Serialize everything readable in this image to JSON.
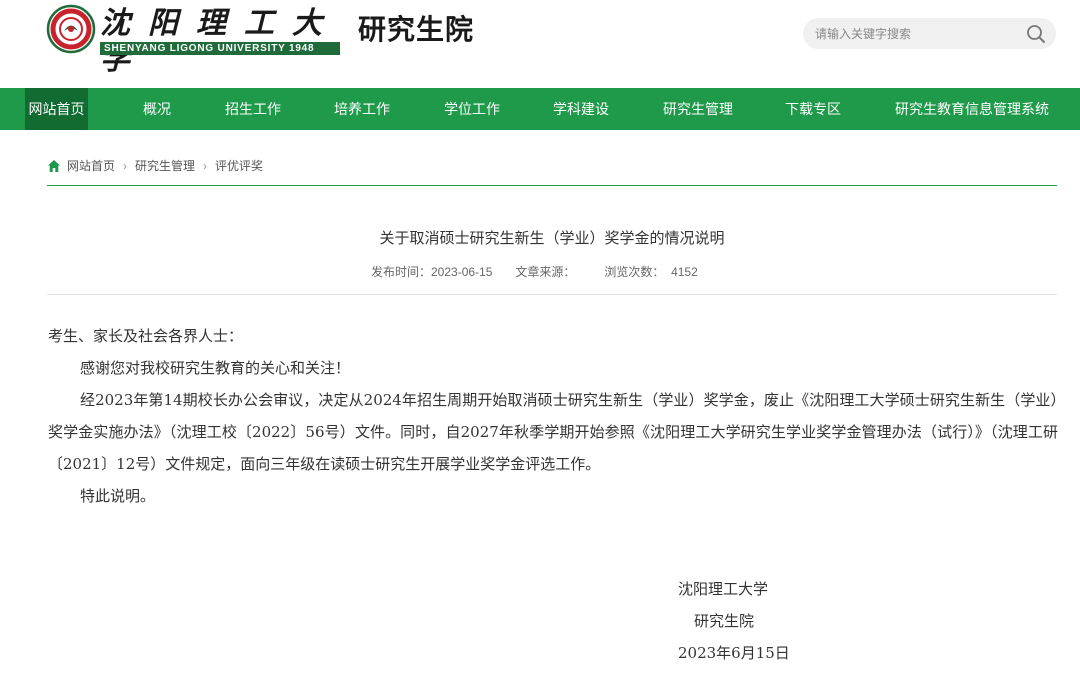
{
  "header": {
    "logo_cn": "沈阳理工大学",
    "logo_en": "SHENYANG LIGONG UNIVERSITY 1948",
    "site_sub": "研究生院",
    "search_placeholder": "请输入关键字搜索",
    "search_icon": "search-icon"
  },
  "nav": {
    "items": [
      {
        "label": "网站首页",
        "active": true
      },
      {
        "label": "概况"
      },
      {
        "label": "招生工作"
      },
      {
        "label": "培养工作"
      },
      {
        "label": "学位工作"
      },
      {
        "label": "学科建设"
      },
      {
        "label": "研究生管理"
      },
      {
        "label": "下载专区"
      },
      {
        "label": "研究生教育信息管理系统"
      }
    ]
  },
  "breadcrumb": {
    "home": "网站首页",
    "sep": "›",
    "level1": "研究生管理",
    "level2": "评优评奖"
  },
  "article": {
    "title": "关于取消硕士研究生新生（学业）奖学金的情况说明",
    "meta_date": "发布时间：2023-06-15",
    "meta_source": "文章来源：",
    "meta_views": "浏览次数：  4152",
    "greeting": "考生、家长及社会各界人士：",
    "para1": "感谢您对我校研究生教育的关心和关注！",
    "para2": "经2023年第14期校长办公会审议，决定从2024年招生周期开始取消硕士研究生新生（学业）奖学金，废止《沈阳理工大学硕士研究生新生（学业）奖学金实施办法》（沈理工校〔2022〕56号）文件。同时，自2027年秋季学期开始参照《沈阳理工大学研究生学业奖学金管理办法（试行）》（沈理工研〔2021〕12号）文件规定，面向三年级在读硕士研究生开展学业奖学金评选工作。",
    "para3": "特此说明。",
    "sign_org": "沈阳理工大学",
    "sign_dept": "研究生院",
    "sign_date": "2023年6月15日"
  },
  "colors": {
    "nav_green": "#1e9a4a",
    "nav_active": "#126b31",
    "logo_red": "#c8232c"
  }
}
